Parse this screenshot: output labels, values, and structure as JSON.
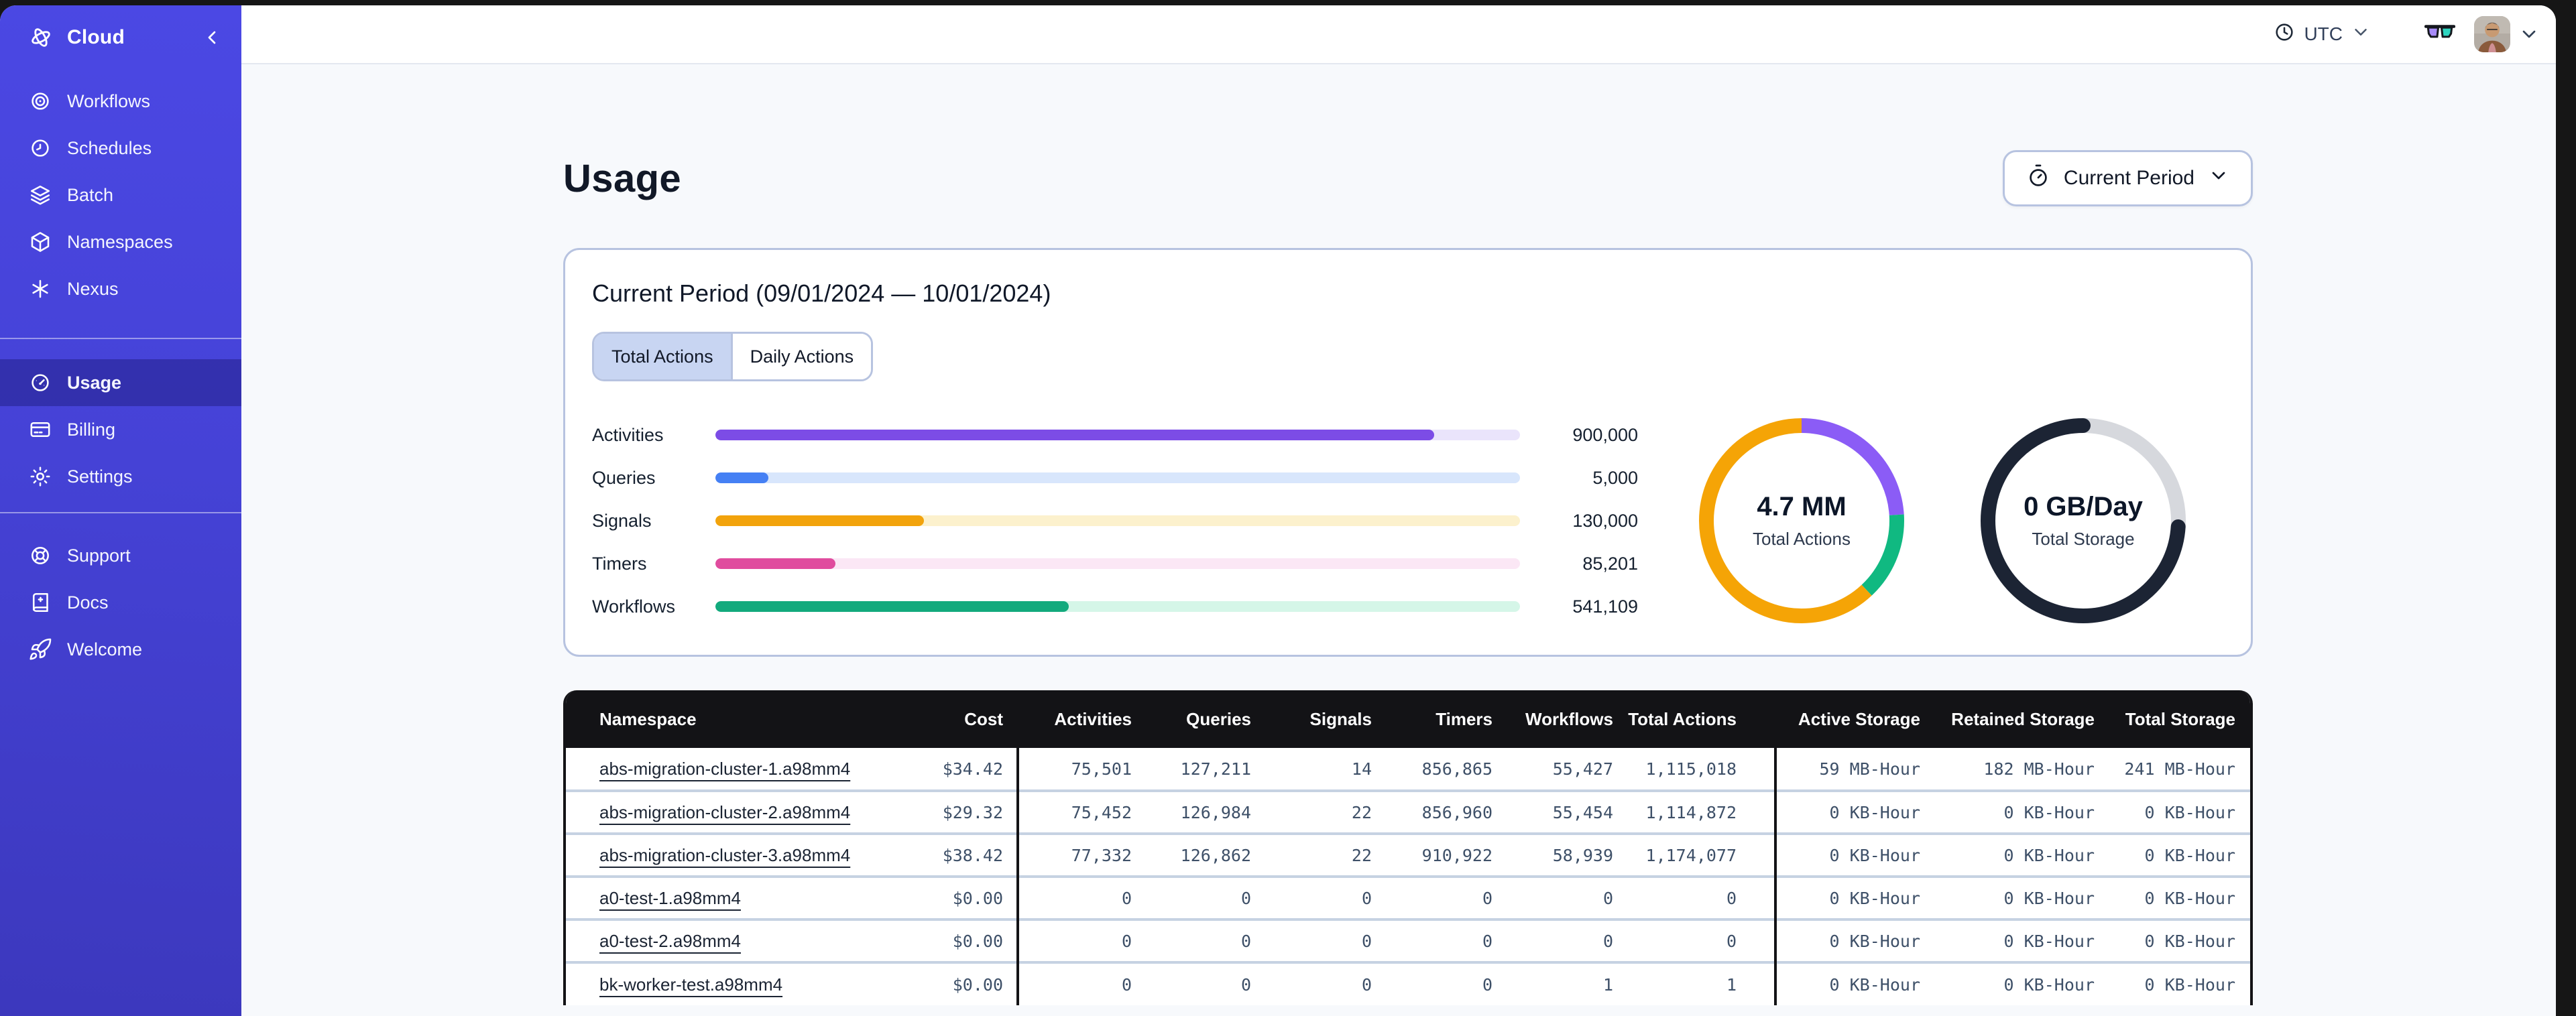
{
  "header": {
    "timezone": "UTC"
  },
  "sidebar": {
    "brand": "Cloud",
    "groups": {
      "main": [
        {
          "label": "Workflows",
          "icon": "workflows"
        },
        {
          "label": "Schedules",
          "icon": "schedules"
        },
        {
          "label": "Batch",
          "icon": "batch"
        },
        {
          "label": "Namespaces",
          "icon": "namespaces"
        },
        {
          "label": "Nexus",
          "icon": "nexus"
        }
      ],
      "account": [
        {
          "label": "Usage",
          "icon": "usage",
          "active": true
        },
        {
          "label": "Billing",
          "icon": "billing"
        },
        {
          "label": "Settings",
          "icon": "settings"
        }
      ],
      "footer": [
        {
          "label": "Support",
          "icon": "support"
        },
        {
          "label": "Docs",
          "icon": "docs"
        },
        {
          "label": "Welcome",
          "icon": "welcome"
        }
      ]
    }
  },
  "page": {
    "title": "Usage",
    "period_button": "Current Period"
  },
  "card": {
    "title": "Current Period (09/01/2024 — 10/01/2024)",
    "tabs": [
      {
        "label": "Total Actions",
        "active": true
      },
      {
        "label": "Daily Actions",
        "active": false
      }
    ]
  },
  "chart_data": [
    {
      "type": "bar",
      "title": "Total Actions by action type",
      "categories": [
        "Activities",
        "Queries",
        "Signals",
        "Timers",
        "Workflows"
      ],
      "values": [
        900000,
        5000,
        130000,
        85201,
        541109
      ],
      "display_values": [
        "900,000",
        "5,000",
        "130,000",
        "85,201",
        "541,109"
      ],
      "fill_fractions": [
        0.893,
        0.066,
        0.259,
        0.149,
        0.439
      ],
      "colors": [
        "#7c4ce6",
        "#4580f4",
        "#f2a30c",
        "#e04c9e",
        "#13aa7d"
      ],
      "track_colors": [
        "#eae4fb",
        "#d8e6fc",
        "#fcf1cd",
        "#fbe7f5",
        "#d5f6e8"
      ]
    },
    {
      "type": "donut",
      "center_value": "4.7 MM",
      "center_label": "Total Actions",
      "linecap": "butt",
      "segments": [
        {
          "name": "activities",
          "color": "#8b5cf6",
          "fraction": 0.24
        },
        {
          "name": "workflows",
          "color": "#10b981",
          "fraction": 0.14
        },
        {
          "name": "other-actions",
          "color": "#f5a406",
          "fraction": 0.62
        }
      ]
    },
    {
      "type": "donut",
      "center_value": "0 GB/Day",
      "center_label": "Total Storage",
      "linecap": "round",
      "segments": [
        {
          "name": "free",
          "color": "#d6d8dd",
          "fraction": 0.26
        },
        {
          "name": "used",
          "color": "#1c2434",
          "fraction": 0.74
        }
      ]
    }
  ],
  "table": {
    "headers": [
      "Namespace",
      "Cost",
      "Activities",
      "Queries",
      "Signals",
      "Timers",
      "Workflows",
      "Total Actions",
      "Active Storage",
      "Retained Storage",
      "Total Storage"
    ],
    "rows": [
      [
        "abs-migration-cluster-1.a98mm4",
        "$34.42",
        "75,501",
        "127,211",
        "14",
        "856,865",
        "55,427",
        "1,115,018",
        "59 MB-Hour",
        "182 MB-Hour",
        "241 MB-Hour"
      ],
      [
        "abs-migration-cluster-2.a98mm4",
        "$29.32",
        "75,452",
        "126,984",
        "22",
        "856,960",
        "55,454",
        "1,114,872",
        "0 KB-Hour",
        "0 KB-Hour",
        "0 KB-Hour"
      ],
      [
        "abs-migration-cluster-3.a98mm4",
        "$38.42",
        "77,332",
        "126,862",
        "22",
        "910,922",
        "58,939",
        "1,174,077",
        "0 KB-Hour",
        "0 KB-Hour",
        "0 KB-Hour"
      ],
      [
        "a0-test-1.a98mm4",
        "$0.00",
        "0",
        "0",
        "0",
        "0",
        "0",
        "0",
        "0 KB-Hour",
        "0 KB-Hour",
        "0 KB-Hour"
      ],
      [
        "a0-test-2.a98mm4",
        "$0.00",
        "0",
        "0",
        "0",
        "0",
        "0",
        "0",
        "0 KB-Hour",
        "0 KB-Hour",
        "0 KB-Hour"
      ],
      [
        "bk-worker-test.a98mm4",
        "$0.00",
        "0",
        "0",
        "0",
        "0",
        "1",
        "1",
        "0 KB-Hour",
        "0 KB-Hour",
        "0 KB-Hour"
      ]
    ]
  }
}
